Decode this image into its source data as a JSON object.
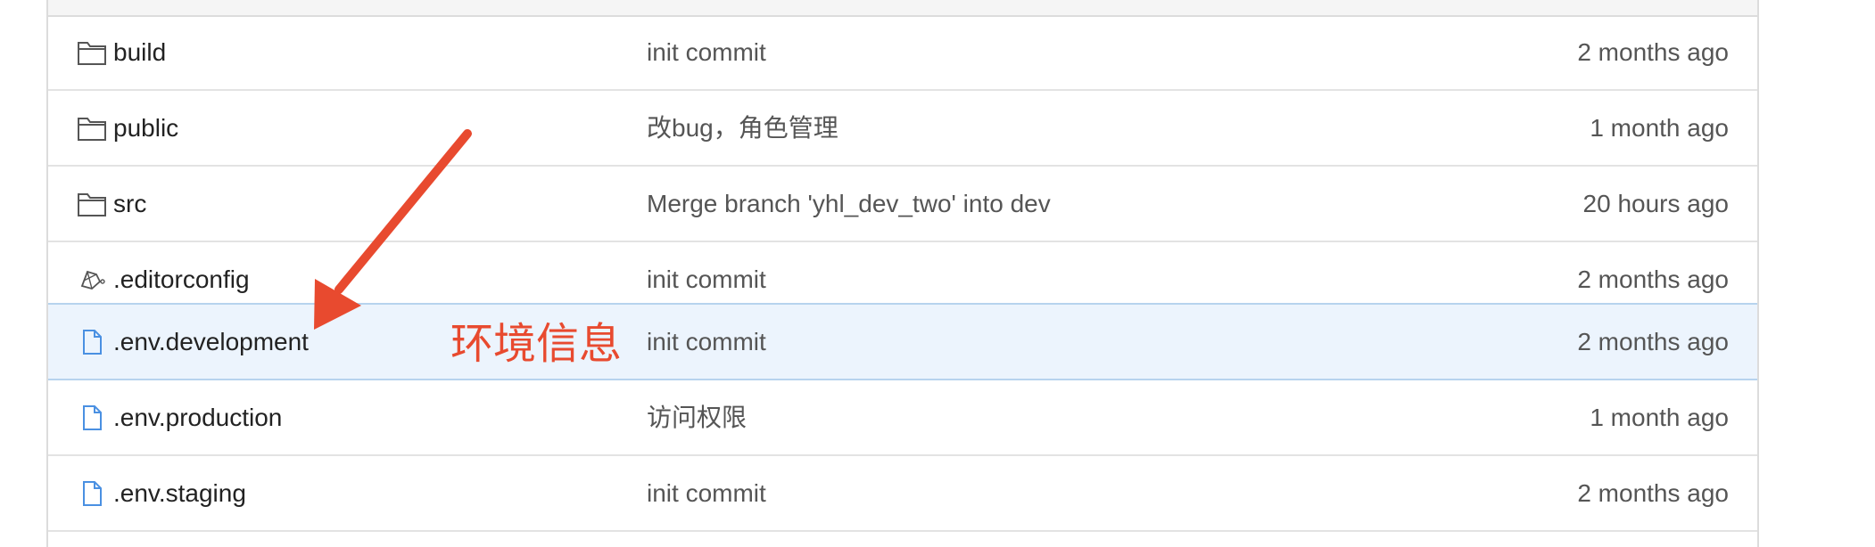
{
  "files": [
    {
      "icon": "folder-icon",
      "name": "build",
      "commit": "init commit",
      "time": "2 months ago"
    },
    {
      "icon": "folder-icon",
      "name": "public",
      "commit": "改bug，角色管理",
      "time": "1 month ago"
    },
    {
      "icon": "folder-icon",
      "name": "src",
      "commit": "Merge branch 'yhl_dev_two' into dev",
      "time": "20 hours ago"
    },
    {
      "icon": "editorconfig-icon",
      "name": ".editorconfig",
      "commit": "init commit",
      "time": "2 months ago"
    },
    {
      "icon": "file-icon",
      "name": ".env.development",
      "commit": "init commit",
      "time": "2 months ago"
    },
    {
      "icon": "file-icon",
      "name": ".env.production",
      "commit": "访问权限",
      "time": "1 month ago"
    },
    {
      "icon": "file-icon",
      "name": ".env.staging",
      "commit": "init commit",
      "time": "2 months ago"
    }
  ],
  "annotation": {
    "text": "环境信息",
    "color": "#e84a2f"
  },
  "colors": {
    "highlight_row": "#ecf4fd",
    "file_icon": "#4a90e2",
    "folder_icon": "#555555"
  }
}
